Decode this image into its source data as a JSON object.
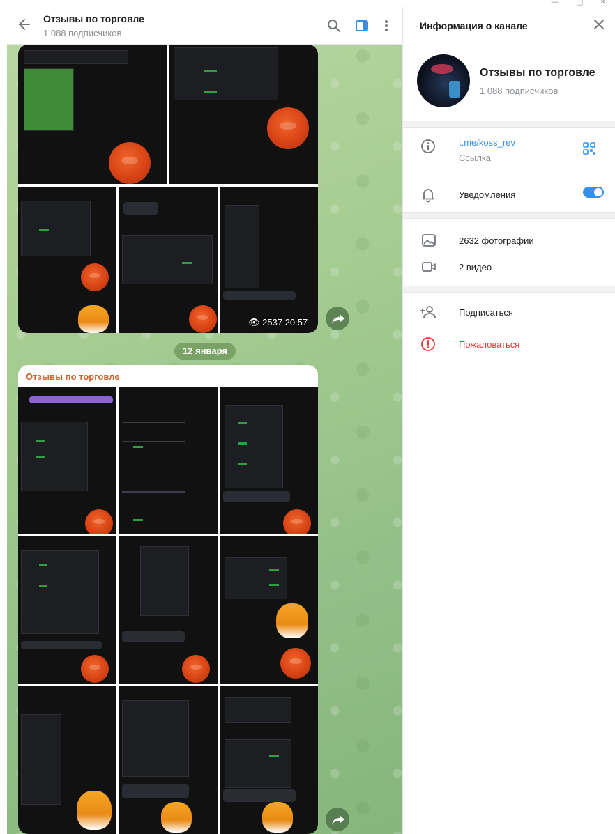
{
  "chat": {
    "title": "Отзывы по торговле",
    "subscribers": "1 088 подписчиков",
    "date_separator": "12 января",
    "album_author": "Отзывы по торговле",
    "post1_views": "2537",
    "post1_time": "20:57"
  },
  "info": {
    "panel_title": "Информация о канале",
    "channel_name": "Отзывы по торговле",
    "channel_subscribers": "1 088 подписчиков",
    "link": "t.me/koss_rev",
    "link_caption": "Ссылка",
    "notifications_label": "Уведомления",
    "notifications_on": true,
    "photos": "2632 фотографии",
    "videos": "2 видео",
    "subscribe": "Подписаться",
    "report": "Пожаловаться"
  },
  "colors": {
    "accent": "#3390ec",
    "author": "#d2622d",
    "danger": "#e53935"
  },
  "icons": [
    "back-arrow-icon",
    "search-icon",
    "sidebar-toggle-icon",
    "more-vertical-icon",
    "close-icon",
    "info-icon",
    "qr-code-icon",
    "bell-icon",
    "photo-icon",
    "video-icon",
    "add-user-icon",
    "report-icon",
    "share-icon",
    "eye-icon"
  ]
}
